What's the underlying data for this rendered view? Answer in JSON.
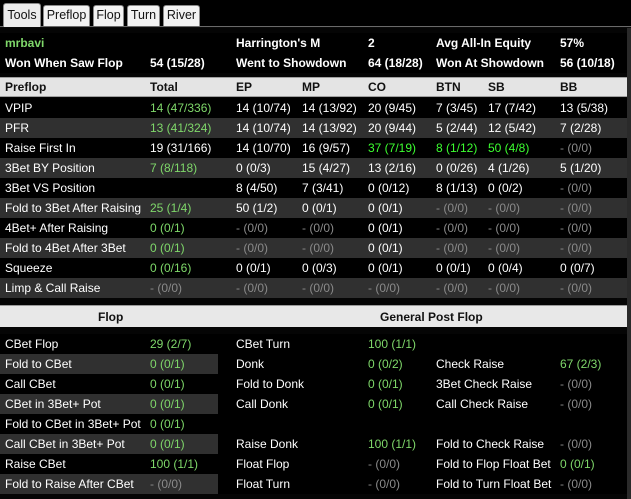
{
  "tabs": [
    "Tools",
    "Preflop",
    "Flop",
    "Turn",
    "River"
  ],
  "player": "mrbavi",
  "summary": {
    "harrington_label": "Harrington's M",
    "harrington_value": "2",
    "equity_label": "Avg All-In Equity",
    "equity_value": "57%",
    "wwsf_label": "Won When Saw Flop",
    "wwsf_value": "54 (15/28)",
    "wtsd_label": "Went to Showdown",
    "wtsd_value": "64 (18/28)",
    "wsd_label": "Won At Showdown",
    "wsd_value": "56 (10/18)"
  },
  "preflop": {
    "headers": [
      "Preflop",
      "Total",
      "EP",
      "MP",
      "CO",
      "BTN",
      "SB",
      "BB"
    ],
    "rows": [
      {
        "label": "VPIP",
        "values": [
          "14 (47/336)",
          "14 (10/74)",
          "14 (13/92)",
          "20 (9/45)",
          "7 (3/45)",
          "17 (7/42)",
          "13 (5/38)"
        ],
        "colors": [
          "g",
          "w",
          "w",
          "w",
          "w",
          "w",
          "w"
        ]
      },
      {
        "label": "PFR",
        "values": [
          "13 (41/324)",
          "14 (10/74)",
          "14 (13/92)",
          "20 (9/44)",
          "5 (2/44)",
          "12 (5/42)",
          "7 (2/28)"
        ],
        "colors": [
          "g",
          "w",
          "w",
          "w",
          "w",
          "w",
          "w"
        ]
      },
      {
        "label": "Raise First In",
        "values": [
          "19 (31/166)",
          "14 (10/70)",
          "16 (9/57)",
          "37 (7/19)",
          "8 (1/12)",
          "50 (4/8)",
          "- (0/0)"
        ],
        "colors": [
          "w",
          "w",
          "w",
          "b",
          "b",
          "b",
          "x"
        ]
      },
      {
        "label": "3Bet BY Position",
        "values": [
          "7 (8/118)",
          "0 (0/3)",
          "15 (4/27)",
          "13 (2/16)",
          "0 (0/26)",
          "4 (1/26)",
          "5 (1/20)"
        ],
        "colors": [
          "g",
          "w",
          "w",
          "w",
          "w",
          "w",
          "w"
        ]
      },
      {
        "label": "3Bet VS Position",
        "values": [
          "",
          "8 (4/50)",
          "7 (3/41)",
          "0 (0/12)",
          "8 (1/13)",
          "0 (0/2)",
          "- (0/0)"
        ],
        "colors": [
          "w",
          "w",
          "w",
          "w",
          "w",
          "w",
          "x"
        ]
      },
      {
        "label": "Fold to 3Bet After Raising",
        "values": [
          "25 (1/4)",
          "50 (1/2)",
          "0 (0/1)",
          "0 (0/1)",
          "- (0/0)",
          "- (0/0)",
          "- (0/0)"
        ],
        "colors": [
          "g",
          "w",
          "w",
          "w",
          "x",
          "x",
          "x"
        ]
      },
      {
        "label": "4Bet+ After Raising",
        "values": [
          "0 (0/1)",
          "- (0/0)",
          "- (0/0)",
          "0 (0/1)",
          "- (0/0)",
          "- (0/0)",
          "- (0/0)"
        ],
        "colors": [
          "g",
          "x",
          "x",
          "w",
          "x",
          "x",
          "x"
        ]
      },
      {
        "label": "Fold to 4Bet After 3Bet",
        "values": [
          "0 (0/1)",
          "- (0/0)",
          "- (0/0)",
          "0 (0/1)",
          "- (0/0)",
          "- (0/0)",
          "- (0/0)"
        ],
        "colors": [
          "g",
          "x",
          "x",
          "w",
          "x",
          "x",
          "x"
        ]
      },
      {
        "label": "Squeeze",
        "values": [
          "0 (0/16)",
          "0 (0/1)",
          "0 (0/3)",
          "0 (0/1)",
          "0 (0/1)",
          "0 (0/4)",
          "0 (0/7)"
        ],
        "colors": [
          "g",
          "w",
          "w",
          "w",
          "w",
          "w",
          "w"
        ]
      },
      {
        "label": "Limp & Call Raise",
        "values": [
          "- (0/0)",
          "- (0/0)",
          "- (0/0)",
          "- (0/0)",
          "- (0/0)",
          "- (0/0)",
          "- (0/0)"
        ],
        "colors": [
          "x",
          "x",
          "x",
          "x",
          "x",
          "x",
          "x"
        ]
      }
    ]
  },
  "flop_section": {
    "title": "Flop",
    "general_title": "General Post Flop"
  },
  "flop": [
    {
      "label": "CBet Flop",
      "value": "29 (2/7)"
    },
    {
      "label": "Fold to CBet",
      "value": "0 (0/1)"
    },
    {
      "label": "Call CBet",
      "value": "0 (0/1)"
    },
    {
      "label": "CBet in 3Bet+ Pot",
      "value": "0 (0/1)"
    },
    {
      "label": "Fold to CBet in 3Bet+ Pot",
      "value": "0 (0/1)"
    },
    {
      "label": "Call CBet in 3Bet+ Pot",
      "value": "0 (0/1)"
    },
    {
      "label": "Raise CBet",
      "value": "100 (1/1)"
    },
    {
      "label": "Fold to Raise After CBet",
      "value": "- (0/0)"
    }
  ],
  "general_mid": [
    {
      "label": "CBet Turn",
      "value": "100 (1/1)"
    },
    {
      "label": "Donk",
      "value": "0 (0/2)"
    },
    {
      "label": "Fold to Donk",
      "value": "0 (0/1)"
    },
    {
      "label": "Call Donk",
      "value": "0 (0/1)"
    },
    {
      "label": "",
      "value": ""
    },
    {
      "label": "Raise Donk",
      "value": "100 (1/1)"
    },
    {
      "label": "Float Flop",
      "value": "- (0/0)"
    },
    {
      "label": "Float Turn",
      "value": "- (0/0)"
    }
  ],
  "general_right": [
    {
      "label": "",
      "value": ""
    },
    {
      "label": "Check Raise",
      "value": "67 (2/3)"
    },
    {
      "label": "3Bet Check Raise",
      "value": "- (0/0)"
    },
    {
      "label": "Call Check Raise",
      "value": "- (0/0)"
    },
    {
      "label": "",
      "value": ""
    },
    {
      "label": "Fold to Check Raise",
      "value": "- (0/0)"
    },
    {
      "label": "Fold to Flop Float Bet",
      "value": "0 (0/1)"
    },
    {
      "label": "Fold to Turn Float Bet",
      "value": "- (0/0)"
    }
  ],
  "colors": {
    "green": "#7fd86a",
    "bright_green": "#3cff30",
    "gray": "#8a8a8a",
    "header_bg": "#e4e4e4",
    "row_alt": "#303030"
  }
}
